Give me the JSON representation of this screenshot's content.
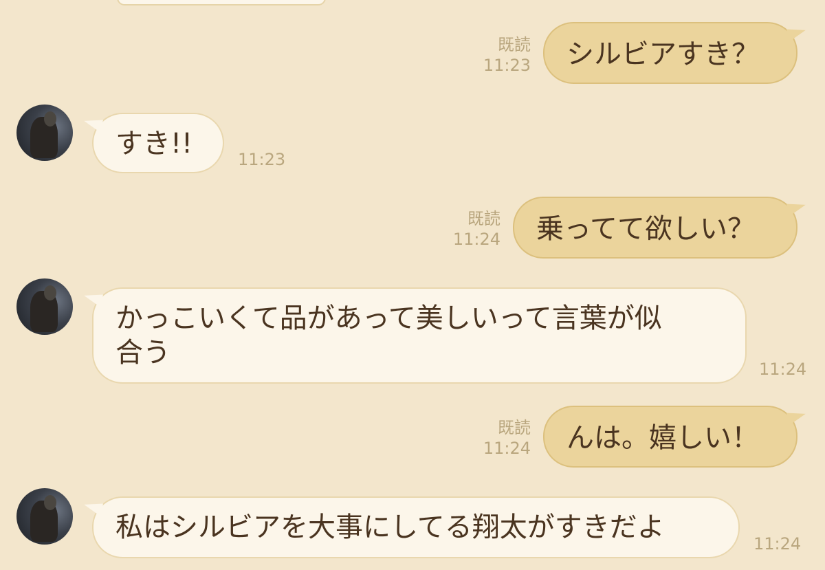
{
  "messages": [
    {
      "side": "out",
      "text": "シルビアすき？",
      "read": "既読",
      "time": "11:23"
    },
    {
      "side": "in",
      "text": "すき!!",
      "time": "11:23"
    },
    {
      "side": "out",
      "text": "乗ってて欲しい？",
      "read": "既読",
      "time": "11:24"
    },
    {
      "side": "in",
      "text_line1": "かっこいくて品があって美しいって言葉が似",
      "text_line2": "合う",
      "time": "11:24"
    },
    {
      "side": "out",
      "text": "んは。嬉しい！",
      "read": "既読",
      "time": "11:24"
    },
    {
      "side": "in",
      "text": "私はシルビアを大事にしてる翔太がすきだよ",
      "time": "11:24"
    }
  ],
  "colors": {
    "background": "#f3e6cc",
    "outgoing_bubble": "#ebd49c",
    "incoming_bubble": "#fcf6ea",
    "text": "#4a3420",
    "meta": "#b9a67e"
  },
  "icons": {
    "avatar": "contact-avatar-photo"
  }
}
